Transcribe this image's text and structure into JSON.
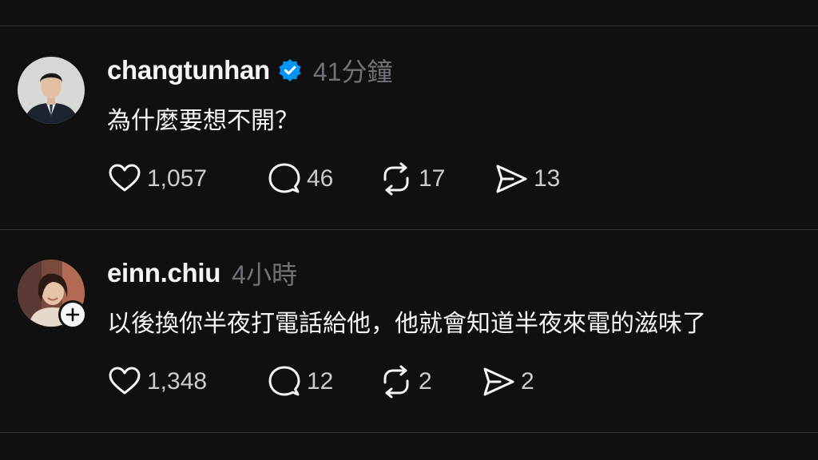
{
  "posts": [
    {
      "username": "changtunhan",
      "verified": true,
      "time": "41分鐘",
      "text": "為什麼要想不開？",
      "likes": "1,057",
      "comments": "46",
      "reposts": "17",
      "shares": "13"
    },
    {
      "username": "einn.chiu",
      "verified": false,
      "time": "4小時",
      "text": "以後換你半夜打電話給他，他就會知道半夜來電的滋味了",
      "likes": "1,348",
      "comments": "12",
      "reposts": "2",
      "shares": "2"
    }
  ],
  "icons": {
    "like": "heart-icon",
    "comment": "speech-bubble-icon",
    "repost": "repost-arrows-icon",
    "share": "send-icon",
    "verified": "verified-badge-icon",
    "follow": "plus-icon"
  },
  "colors": {
    "background": "#101010",
    "text": "#f3f5f7",
    "muted": "#6f7377",
    "verified": "#0095f6",
    "divider": "#333638"
  }
}
